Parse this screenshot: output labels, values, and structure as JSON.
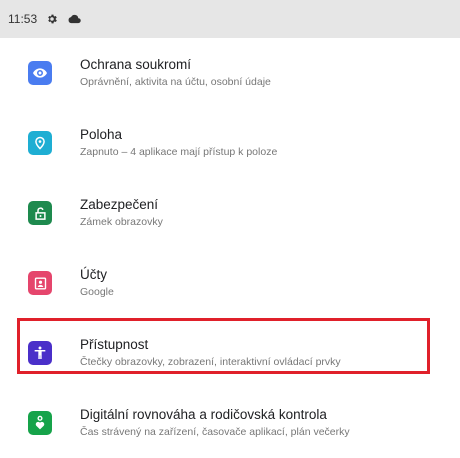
{
  "status_bar": {
    "time": "11:53",
    "icons": [
      "gear-icon",
      "cloud-icon"
    ]
  },
  "settings": [
    {
      "key": "privacy",
      "title": "Ochrana soukromí",
      "subtitle": "Oprávnění, aktivita na účtu, osobní údaje",
      "icon": "privacy-eye-icon",
      "color": "#4a7cf0"
    },
    {
      "key": "location",
      "title": "Poloha",
      "subtitle": "Zapnuto – 4 aplikace mají přístup k poloze",
      "icon": "location-pin-icon",
      "color": "#1eaed3"
    },
    {
      "key": "security",
      "title": "Zabezpečení",
      "subtitle": "Zámek obrazovky",
      "icon": "unlocked-padlock-icon",
      "color": "#1e8a4e"
    },
    {
      "key": "accounts",
      "title": "Účty",
      "subtitle": "Google",
      "icon": "account-card-icon",
      "color": "#e5456c"
    },
    {
      "key": "accessibility",
      "title": "Přístupnost",
      "subtitle": "Čtečky obrazovky, zobrazení, interaktivní ovládací prvky",
      "icon": "accessibility-person-icon",
      "color": "#4a2fc9",
      "highlighted": true
    },
    {
      "key": "digital-wellbeing",
      "title": "Digitální rovnováha a rodičovská kontrola",
      "subtitle": "Čas strávený na zařízení, časovače aplikací, plán večerky",
      "icon": "wellbeing-heart-icon",
      "color": "#16a34a"
    }
  ],
  "highlight_color": "#e0202a"
}
